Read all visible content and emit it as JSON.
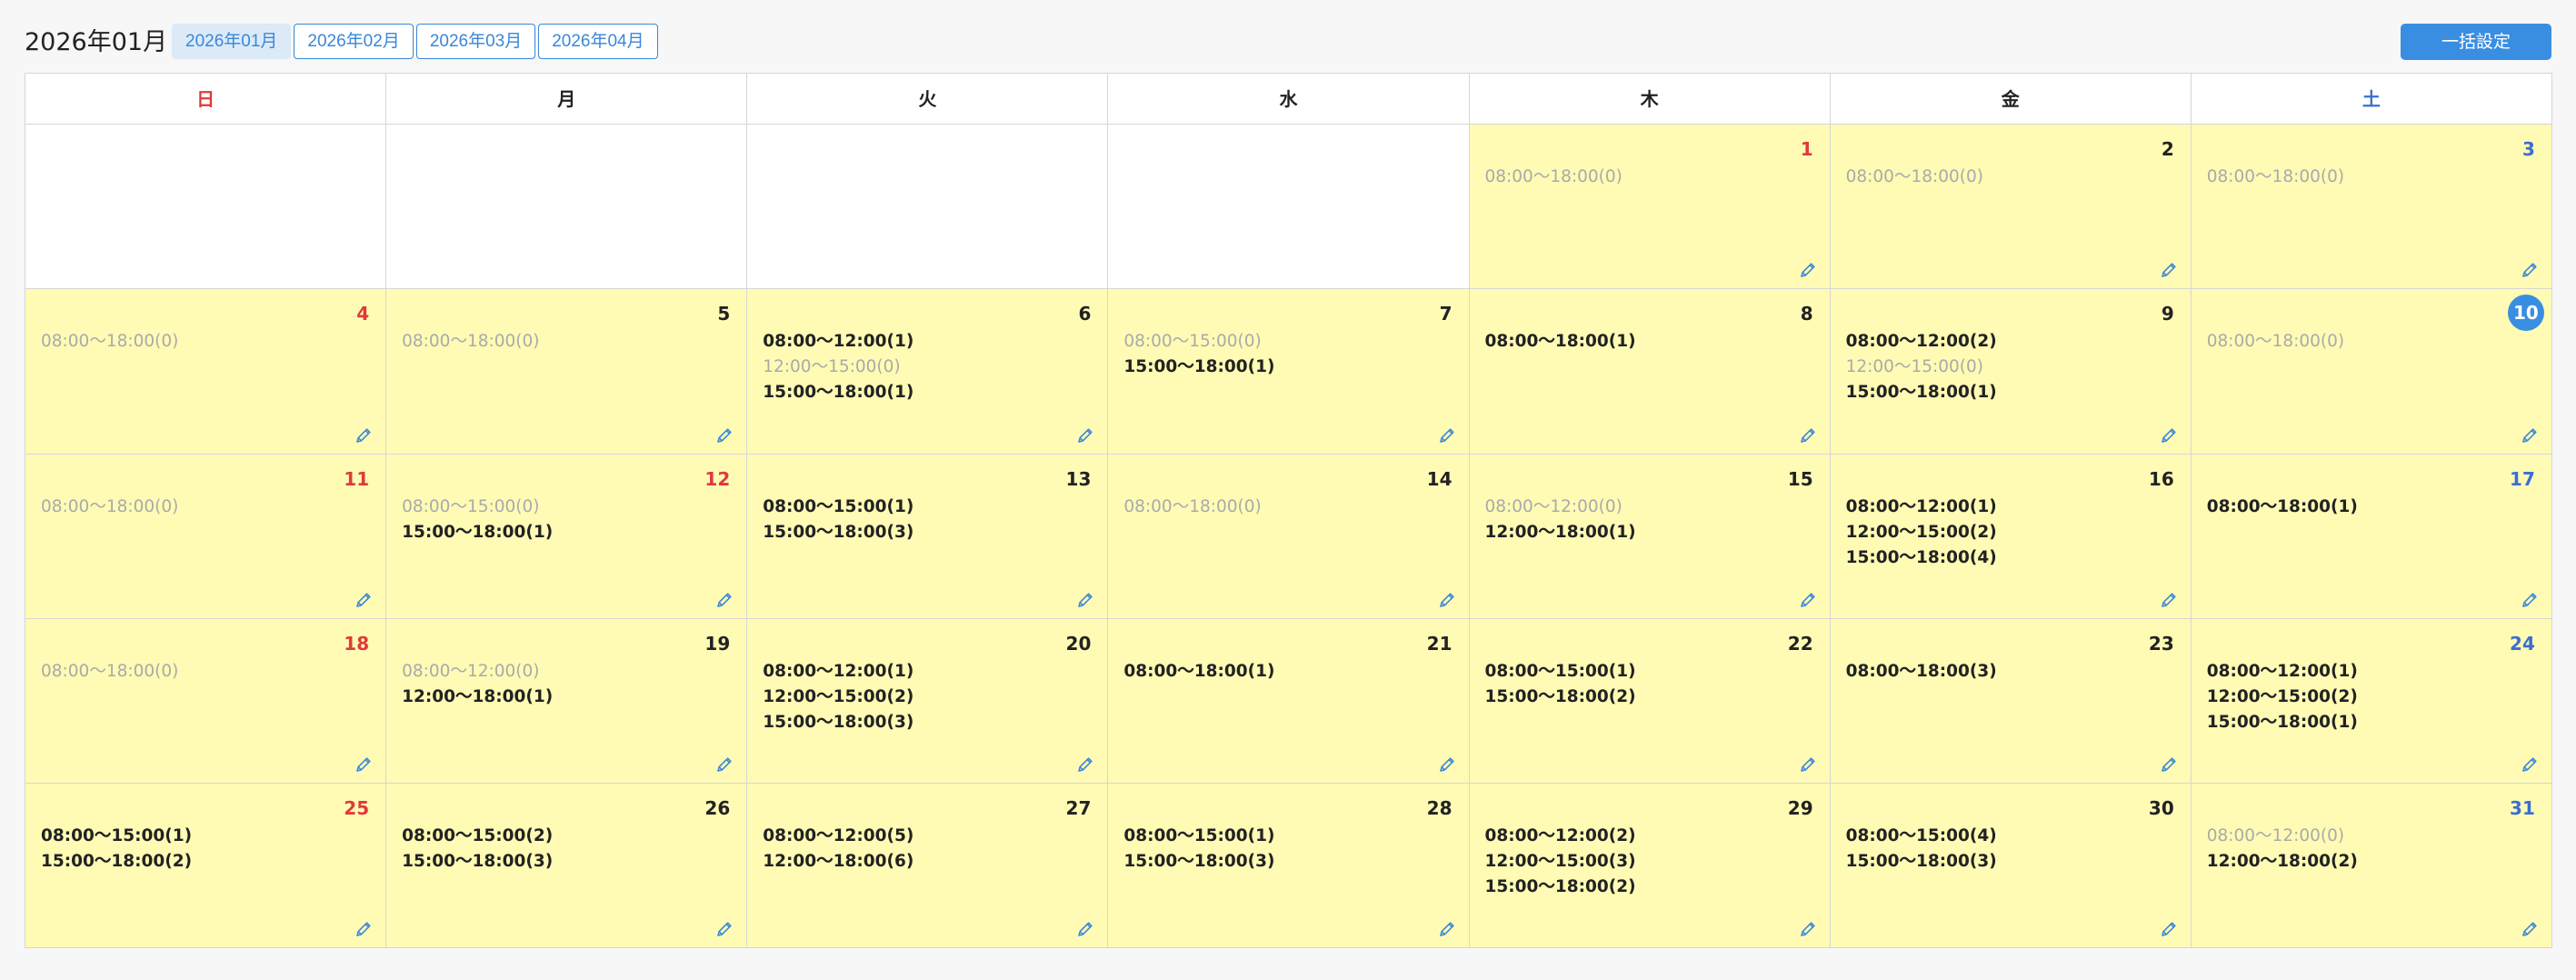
{
  "header": {
    "title": "2026年01月",
    "tabs": [
      {
        "label": "2026年01月",
        "active": true
      },
      {
        "label": "2026年02月",
        "active": false
      },
      {
        "label": "2026年03月",
        "active": false
      },
      {
        "label": "2026年04月",
        "active": false
      }
    ],
    "bulk_button": "一括設定"
  },
  "colors": {
    "accent": "#3a8ee2",
    "sunday": "#e03a3a",
    "saturday": "#3a6fd0",
    "cell_bg": "#fffbb5"
  },
  "weekdays": [
    "日",
    "月",
    "火",
    "水",
    "木",
    "金",
    "土"
  ],
  "weeks": [
    [
      null,
      null,
      null,
      null,
      {
        "day": "1",
        "holiday": true,
        "slots": [
          {
            "text": "08:00〜18:00(0)",
            "count": 0
          }
        ]
      },
      {
        "day": "2",
        "slots": [
          {
            "text": "08:00〜18:00(0)",
            "count": 0
          }
        ]
      },
      {
        "day": "3",
        "slots": [
          {
            "text": "08:00〜18:00(0)",
            "count": 0
          }
        ]
      }
    ],
    [
      {
        "day": "4",
        "slots": [
          {
            "text": "08:00〜18:00(0)",
            "count": 0
          }
        ]
      },
      {
        "day": "5",
        "slots": [
          {
            "text": "08:00〜18:00(0)",
            "count": 0
          }
        ]
      },
      {
        "day": "6",
        "slots": [
          {
            "text": "08:00〜12:00(1)",
            "count": 1
          },
          {
            "text": "12:00〜15:00(0)",
            "count": 0
          },
          {
            "text": "15:00〜18:00(1)",
            "count": 1
          }
        ]
      },
      {
        "day": "7",
        "slots": [
          {
            "text": "08:00〜15:00(0)",
            "count": 0
          },
          {
            "text": "15:00〜18:00(1)",
            "count": 1
          }
        ]
      },
      {
        "day": "8",
        "slots": [
          {
            "text": "08:00〜18:00(1)",
            "count": 1
          }
        ]
      },
      {
        "day": "9",
        "slots": [
          {
            "text": "08:00〜12:00(2)",
            "count": 2
          },
          {
            "text": "12:00〜15:00(0)",
            "count": 0
          },
          {
            "text": "15:00〜18:00(1)",
            "count": 1
          }
        ]
      },
      {
        "day": "10",
        "today": true,
        "slots": [
          {
            "text": "08:00〜18:00(0)",
            "count": 0
          }
        ]
      }
    ],
    [
      {
        "day": "11",
        "slots": [
          {
            "text": "08:00〜18:00(0)",
            "count": 0
          }
        ]
      },
      {
        "day": "12",
        "holiday": true,
        "slots": [
          {
            "text": "08:00〜15:00(0)",
            "count": 0
          },
          {
            "text": "15:00〜18:00(1)",
            "count": 1
          }
        ]
      },
      {
        "day": "13",
        "slots": [
          {
            "text": "08:00〜15:00(1)",
            "count": 1
          },
          {
            "text": "15:00〜18:00(3)",
            "count": 3
          }
        ]
      },
      {
        "day": "14",
        "slots": [
          {
            "text": "08:00〜18:00(0)",
            "count": 0
          }
        ]
      },
      {
        "day": "15",
        "slots": [
          {
            "text": "08:00〜12:00(0)",
            "count": 0
          },
          {
            "text": "12:00〜18:00(1)",
            "count": 1
          }
        ]
      },
      {
        "day": "16",
        "slots": [
          {
            "text": "08:00〜12:00(1)",
            "count": 1
          },
          {
            "text": "12:00〜15:00(2)",
            "count": 2
          },
          {
            "text": "15:00〜18:00(4)",
            "count": 4
          }
        ]
      },
      {
        "day": "17",
        "slots": [
          {
            "text": "08:00〜18:00(1)",
            "count": 1
          }
        ]
      }
    ],
    [
      {
        "day": "18",
        "slots": [
          {
            "text": "08:00〜18:00(0)",
            "count": 0
          }
        ]
      },
      {
        "day": "19",
        "slots": [
          {
            "text": "08:00〜12:00(0)",
            "count": 0
          },
          {
            "text": "12:00〜18:00(1)",
            "count": 1
          }
        ]
      },
      {
        "day": "20",
        "slots": [
          {
            "text": "08:00〜12:00(1)",
            "count": 1
          },
          {
            "text": "12:00〜15:00(2)",
            "count": 2
          },
          {
            "text": "15:00〜18:00(3)",
            "count": 3
          }
        ]
      },
      {
        "day": "21",
        "slots": [
          {
            "text": "08:00〜18:00(1)",
            "count": 1
          }
        ]
      },
      {
        "day": "22",
        "slots": [
          {
            "text": "08:00〜15:00(1)",
            "count": 1
          },
          {
            "text": "15:00〜18:00(2)",
            "count": 2
          }
        ]
      },
      {
        "day": "23",
        "slots": [
          {
            "text": "08:00〜18:00(3)",
            "count": 3
          }
        ]
      },
      {
        "day": "24",
        "slots": [
          {
            "text": "08:00〜12:00(1)",
            "count": 1
          },
          {
            "text": "12:00〜15:00(2)",
            "count": 2
          },
          {
            "text": "15:00〜18:00(1)",
            "count": 1
          }
        ]
      }
    ],
    [
      {
        "day": "25",
        "slots": [
          {
            "text": "08:00〜15:00(1)",
            "count": 1
          },
          {
            "text": "15:00〜18:00(2)",
            "count": 2
          }
        ]
      },
      {
        "day": "26",
        "slots": [
          {
            "text": "08:00〜15:00(2)",
            "count": 2
          },
          {
            "text": "15:00〜18:00(3)",
            "count": 3
          }
        ]
      },
      {
        "day": "27",
        "slots": [
          {
            "text": "08:00〜12:00(5)",
            "count": 5
          },
          {
            "text": "12:00〜18:00(6)",
            "count": 6
          }
        ]
      },
      {
        "day": "28",
        "slots": [
          {
            "text": "08:00〜15:00(1)",
            "count": 1
          },
          {
            "text": "15:00〜18:00(3)",
            "count": 3
          }
        ]
      },
      {
        "day": "29",
        "slots": [
          {
            "text": "08:00〜12:00(2)",
            "count": 2
          },
          {
            "text": "12:00〜15:00(3)",
            "count": 3
          },
          {
            "text": "15:00〜18:00(2)",
            "count": 2
          }
        ]
      },
      {
        "day": "30",
        "slots": [
          {
            "text": "08:00〜15:00(4)",
            "count": 4
          },
          {
            "text": "15:00〜18:00(3)",
            "count": 3
          }
        ]
      },
      {
        "day": "31",
        "slots": [
          {
            "text": "08:00〜12:00(0)",
            "count": 0
          },
          {
            "text": "12:00〜18:00(2)",
            "count": 2
          }
        ]
      }
    ]
  ],
  "icons": {
    "edit": "pencil-icon"
  }
}
